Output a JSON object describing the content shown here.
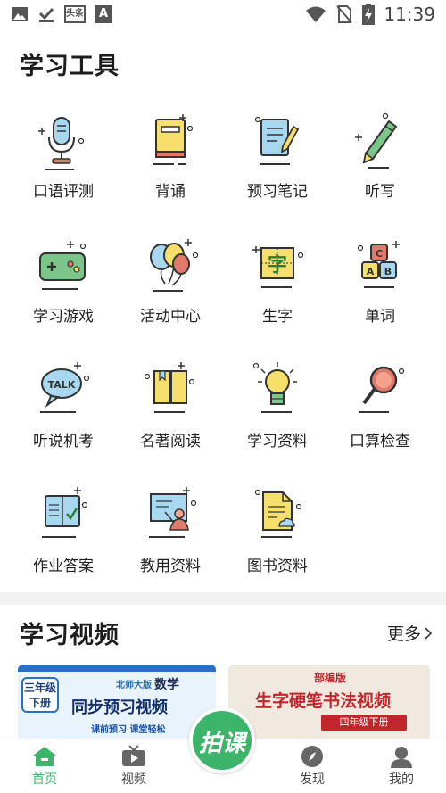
{
  "status_bar": {
    "time": "11:39",
    "app_badge": "头条",
    "icon_letter": "A"
  },
  "tools": {
    "title": "学习工具",
    "items": [
      {
        "label": "口语评测",
        "icon": "microphone-icon"
      },
      {
        "label": "背诵",
        "icon": "book-icon"
      },
      {
        "label": "预习笔记",
        "icon": "notebook-pen-icon"
      },
      {
        "label": "听写",
        "icon": "pencil-icon"
      },
      {
        "label": "学习游戏",
        "icon": "gamepad-icon"
      },
      {
        "label": "活动中心",
        "icon": "balloons-icon"
      },
      {
        "label": "生字",
        "icon": "character-card-icon"
      },
      {
        "label": "单词",
        "icon": "abc-blocks-icon"
      },
      {
        "label": "听说机考",
        "icon": "talk-bubble-icon"
      },
      {
        "label": "名著阅读",
        "icon": "open-book-icon"
      },
      {
        "label": "学习资料",
        "icon": "lightbulb-icon"
      },
      {
        "label": "口算检查",
        "icon": "magnifier-icon"
      },
      {
        "label": "作业答案",
        "icon": "answer-book-icon"
      },
      {
        "label": "教用资料",
        "icon": "teacher-board-icon"
      },
      {
        "label": "图书资料",
        "icon": "document-icon"
      }
    ],
    "icon_text": {
      "character": "字",
      "talk": "TALK",
      "a": "A",
      "b": "B",
      "c": "C"
    }
  },
  "videos": {
    "title": "学习视频",
    "more_label": "更多",
    "cards": [
      {
        "grade": "三年级",
        "volume": "下册",
        "publisher": "北师大版",
        "subject": "数学",
        "title": "同步预习视频",
        "subtitle": "课前预习 课堂轻松"
      },
      {
        "edition": "部编版",
        "title": "生字硬笔书法视频",
        "badge": "四年级下册"
      }
    ]
  },
  "bottom_nav": {
    "items": [
      {
        "label": "首页",
        "active": true
      },
      {
        "label": "视频",
        "active": false
      },
      {
        "label": "发现",
        "active": false
      },
      {
        "label": "我的",
        "active": false
      }
    ],
    "center_label": "拍课"
  },
  "colors": {
    "accent_green": "#3cb46a",
    "icon_yellow": "#f7df6b",
    "icon_blue": "#a8d8f0",
    "icon_red": "#e07a6a",
    "outline": "#333333"
  }
}
